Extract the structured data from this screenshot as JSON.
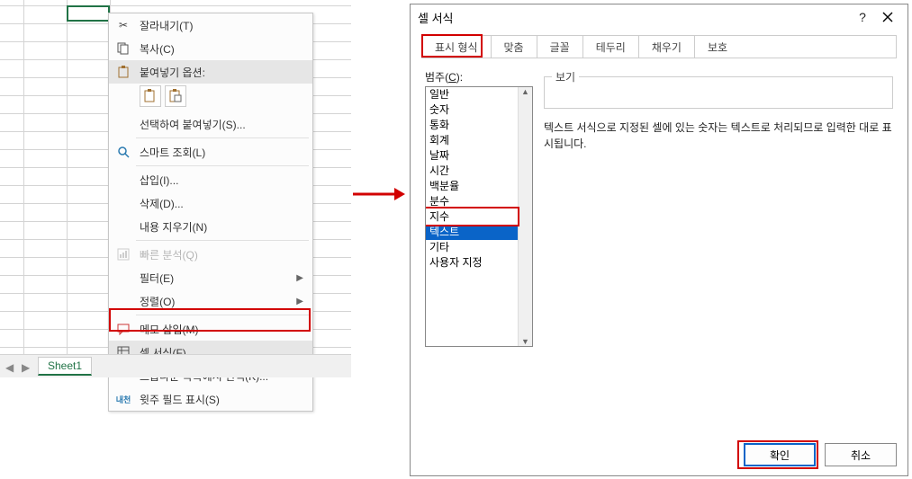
{
  "sheet": {
    "tab_name": "Sheet1"
  },
  "context_menu": {
    "cut": "잘라내기(T)",
    "copy": "복사(C)",
    "paste_options_label": "붙여넣기 옵션:",
    "paste_special": "선택하여 붙여넣기(S)...",
    "smart_lookup": "스마트 조회(L)",
    "insert": "삽입(I)...",
    "delete": "삭제(D)...",
    "clear": "내용 지우기(N)",
    "quick_analysis": "빠른 분석(Q)",
    "filter": "필터(E)",
    "sort": "정렬(O)",
    "insert_comment": "메모 삽입(M)",
    "format_cells": "셀 서식(F)...",
    "pick_dropdown": "드롭다운 목록에서 선택(K)...",
    "show_phonetic": "윗주 필드 표시(S)"
  },
  "dialog": {
    "title": "셀 서식",
    "tabs": {
      "number": "표시 형식",
      "alignment": "맞춤",
      "font": "글꼴",
      "border": "테두리",
      "fill": "채우기",
      "protection": "보호"
    },
    "category_label_pre": "범주(",
    "category_label_u": "C",
    "category_label_post": "):",
    "categories": {
      "general": "일반",
      "number": "숫자",
      "currency": "통화",
      "accounting": "회계",
      "date": "날짜",
      "time": "시간",
      "percentage": "백분율",
      "fraction": "분수",
      "scientific": "지수",
      "text": "텍스트",
      "special": "기타",
      "custom": "사용자 지정"
    },
    "sample_label": "보기",
    "description": "텍스트 서식으로 지정된 셀에 있는 숫자는 텍스트로 처리되므로 입력한 대로 표시됩니다.",
    "ok": "확인",
    "cancel": "취소"
  }
}
